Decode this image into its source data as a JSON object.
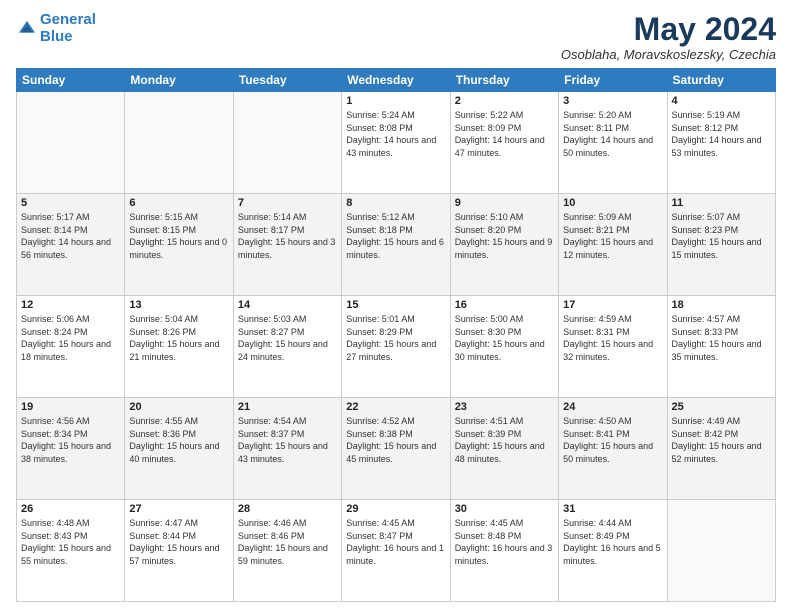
{
  "logo": {
    "line1": "General",
    "line2": "Blue"
  },
  "title": "May 2024",
  "location": "Osoblaha, Moravskoslezsky, Czechia",
  "days_of_week": [
    "Sunday",
    "Monday",
    "Tuesday",
    "Wednesday",
    "Thursday",
    "Friday",
    "Saturday"
  ],
  "weeks": [
    [
      {
        "day": "",
        "sunrise": "",
        "sunset": "",
        "daylight": ""
      },
      {
        "day": "",
        "sunrise": "",
        "sunset": "",
        "daylight": ""
      },
      {
        "day": "",
        "sunrise": "",
        "sunset": "",
        "daylight": ""
      },
      {
        "day": "1",
        "sunrise": "Sunrise: 5:24 AM",
        "sunset": "Sunset: 8:08 PM",
        "daylight": "Daylight: 14 hours and 43 minutes."
      },
      {
        "day": "2",
        "sunrise": "Sunrise: 5:22 AM",
        "sunset": "Sunset: 8:09 PM",
        "daylight": "Daylight: 14 hours and 47 minutes."
      },
      {
        "day": "3",
        "sunrise": "Sunrise: 5:20 AM",
        "sunset": "Sunset: 8:11 PM",
        "daylight": "Daylight: 14 hours and 50 minutes."
      },
      {
        "day": "4",
        "sunrise": "Sunrise: 5:19 AM",
        "sunset": "Sunset: 8:12 PM",
        "daylight": "Daylight: 14 hours and 53 minutes."
      }
    ],
    [
      {
        "day": "5",
        "sunrise": "Sunrise: 5:17 AM",
        "sunset": "Sunset: 8:14 PM",
        "daylight": "Daylight: 14 hours and 56 minutes."
      },
      {
        "day": "6",
        "sunrise": "Sunrise: 5:15 AM",
        "sunset": "Sunset: 8:15 PM",
        "daylight": "Daylight: 15 hours and 0 minutes."
      },
      {
        "day": "7",
        "sunrise": "Sunrise: 5:14 AM",
        "sunset": "Sunset: 8:17 PM",
        "daylight": "Daylight: 15 hours and 3 minutes."
      },
      {
        "day": "8",
        "sunrise": "Sunrise: 5:12 AM",
        "sunset": "Sunset: 8:18 PM",
        "daylight": "Daylight: 15 hours and 6 minutes."
      },
      {
        "day": "9",
        "sunrise": "Sunrise: 5:10 AM",
        "sunset": "Sunset: 8:20 PM",
        "daylight": "Daylight: 15 hours and 9 minutes."
      },
      {
        "day": "10",
        "sunrise": "Sunrise: 5:09 AM",
        "sunset": "Sunset: 8:21 PM",
        "daylight": "Daylight: 15 hours and 12 minutes."
      },
      {
        "day": "11",
        "sunrise": "Sunrise: 5:07 AM",
        "sunset": "Sunset: 8:23 PM",
        "daylight": "Daylight: 15 hours and 15 minutes."
      }
    ],
    [
      {
        "day": "12",
        "sunrise": "Sunrise: 5:06 AM",
        "sunset": "Sunset: 8:24 PM",
        "daylight": "Daylight: 15 hours and 18 minutes."
      },
      {
        "day": "13",
        "sunrise": "Sunrise: 5:04 AM",
        "sunset": "Sunset: 8:26 PM",
        "daylight": "Daylight: 15 hours and 21 minutes."
      },
      {
        "day": "14",
        "sunrise": "Sunrise: 5:03 AM",
        "sunset": "Sunset: 8:27 PM",
        "daylight": "Daylight: 15 hours and 24 minutes."
      },
      {
        "day": "15",
        "sunrise": "Sunrise: 5:01 AM",
        "sunset": "Sunset: 8:29 PM",
        "daylight": "Daylight: 15 hours and 27 minutes."
      },
      {
        "day": "16",
        "sunrise": "Sunrise: 5:00 AM",
        "sunset": "Sunset: 8:30 PM",
        "daylight": "Daylight: 15 hours and 30 minutes."
      },
      {
        "day": "17",
        "sunrise": "Sunrise: 4:59 AM",
        "sunset": "Sunset: 8:31 PM",
        "daylight": "Daylight: 15 hours and 32 minutes."
      },
      {
        "day": "18",
        "sunrise": "Sunrise: 4:57 AM",
        "sunset": "Sunset: 8:33 PM",
        "daylight": "Daylight: 15 hours and 35 minutes."
      }
    ],
    [
      {
        "day": "19",
        "sunrise": "Sunrise: 4:56 AM",
        "sunset": "Sunset: 8:34 PM",
        "daylight": "Daylight: 15 hours and 38 minutes."
      },
      {
        "day": "20",
        "sunrise": "Sunrise: 4:55 AM",
        "sunset": "Sunset: 8:36 PM",
        "daylight": "Daylight: 15 hours and 40 minutes."
      },
      {
        "day": "21",
        "sunrise": "Sunrise: 4:54 AM",
        "sunset": "Sunset: 8:37 PM",
        "daylight": "Daylight: 15 hours and 43 minutes."
      },
      {
        "day": "22",
        "sunrise": "Sunrise: 4:52 AM",
        "sunset": "Sunset: 8:38 PM",
        "daylight": "Daylight: 15 hours and 45 minutes."
      },
      {
        "day": "23",
        "sunrise": "Sunrise: 4:51 AM",
        "sunset": "Sunset: 8:39 PM",
        "daylight": "Daylight: 15 hours and 48 minutes."
      },
      {
        "day": "24",
        "sunrise": "Sunrise: 4:50 AM",
        "sunset": "Sunset: 8:41 PM",
        "daylight": "Daylight: 15 hours and 50 minutes."
      },
      {
        "day": "25",
        "sunrise": "Sunrise: 4:49 AM",
        "sunset": "Sunset: 8:42 PM",
        "daylight": "Daylight: 15 hours and 52 minutes."
      }
    ],
    [
      {
        "day": "26",
        "sunrise": "Sunrise: 4:48 AM",
        "sunset": "Sunset: 8:43 PM",
        "daylight": "Daylight: 15 hours and 55 minutes."
      },
      {
        "day": "27",
        "sunrise": "Sunrise: 4:47 AM",
        "sunset": "Sunset: 8:44 PM",
        "daylight": "Daylight: 15 hours and 57 minutes."
      },
      {
        "day": "28",
        "sunrise": "Sunrise: 4:46 AM",
        "sunset": "Sunset: 8:46 PM",
        "daylight": "Daylight: 15 hours and 59 minutes."
      },
      {
        "day": "29",
        "sunrise": "Sunrise: 4:45 AM",
        "sunset": "Sunset: 8:47 PM",
        "daylight": "Daylight: 16 hours and 1 minute."
      },
      {
        "day": "30",
        "sunrise": "Sunrise: 4:45 AM",
        "sunset": "Sunset: 8:48 PM",
        "daylight": "Daylight: 16 hours and 3 minutes."
      },
      {
        "day": "31",
        "sunrise": "Sunrise: 4:44 AM",
        "sunset": "Sunset: 8:49 PM",
        "daylight": "Daylight: 16 hours and 5 minutes."
      },
      {
        "day": "",
        "sunrise": "",
        "sunset": "",
        "daylight": ""
      }
    ]
  ]
}
